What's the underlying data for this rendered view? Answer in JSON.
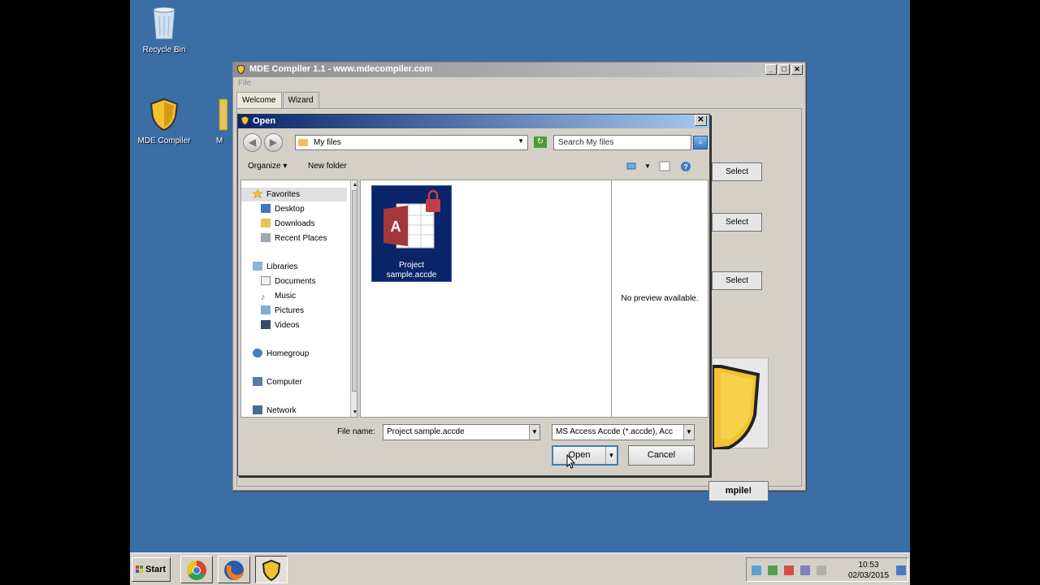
{
  "desktop": {
    "icons": [
      {
        "label": "Recycle Bin"
      },
      {
        "label": "MDE Compiler"
      },
      {
        "label": "M"
      }
    ]
  },
  "app": {
    "title": "MDE Compiler 1.1 - www.mdecompiler.com",
    "menu_file": "File",
    "tabs": [
      {
        "label": "Welcome"
      },
      {
        "label": "Wizard"
      }
    ],
    "select_buttons": [
      "Select",
      "Select",
      "Select"
    ],
    "compile_label": "mpile!"
  },
  "dialog": {
    "title": "Open",
    "address_path": "My files",
    "search_placeholder": "Search My files",
    "organize_label": "Organize",
    "new_folder_label": "New folder",
    "nav": [
      {
        "label": "Favorites"
      },
      {
        "label": "Desktop"
      },
      {
        "label": "Downloads"
      },
      {
        "label": "Recent Places"
      },
      {
        "label": "Libraries"
      },
      {
        "label": "Documents"
      },
      {
        "label": "Music"
      },
      {
        "label": "Pictures"
      },
      {
        "label": "Videos"
      },
      {
        "label": "Homegroup"
      },
      {
        "label": "Computer"
      },
      {
        "label": "Network"
      }
    ],
    "file": {
      "label_line1": "Project",
      "label_line2": "sample.accde",
      "icon_letter": "A"
    },
    "preview_text": "No preview available.",
    "filename_label": "File name:",
    "filename_value": "Project sample.accde",
    "filetype_value": "MS Access Accde (*.accde), Acc",
    "open_label": "Open",
    "cancel_label": "Cancel"
  },
  "taskbar": {
    "start_label": "Start",
    "clock_time": "10:53",
    "clock_date": "02/03/2015"
  },
  "colors": {
    "desktop": "#3a6ea5",
    "dialog_title": "#0a246a",
    "selection": "#0a246a",
    "access_red": "#a4373a"
  }
}
